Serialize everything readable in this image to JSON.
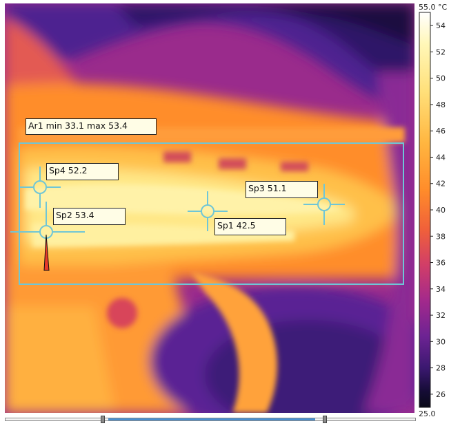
{
  "scale": {
    "top_label": "55.0 °C",
    "bottom_label": "25.0",
    "ticks": [
      "54",
      "52",
      "50",
      "48",
      "46",
      "44",
      "42",
      "40",
      "38",
      "36",
      "34",
      "32",
      "30",
      "28",
      "26"
    ],
    "min": 25.0,
    "max": 55.0,
    "palette": [
      "#ffffff",
      "#fff7b8",
      "#ffe07a",
      "#ffb640",
      "#ff8c2a",
      "#f0603a",
      "#d13e68",
      "#a3298c",
      "#6d2393",
      "#3b1870",
      "#150c35",
      "#0a0a18"
    ]
  },
  "area": {
    "label": "Ar1 min 33.1 max 53.4"
  },
  "spots": [
    {
      "label": "Sp1 42.5"
    },
    {
      "label": "Sp2 53.4"
    },
    {
      "label": "Sp3 51.1"
    },
    {
      "label": "Sp4 52.2"
    }
  ],
  "colors": {
    "marker": "#6fc6d6",
    "hot_marker": "#e83a2a",
    "label_bg": "#fffde6"
  }
}
